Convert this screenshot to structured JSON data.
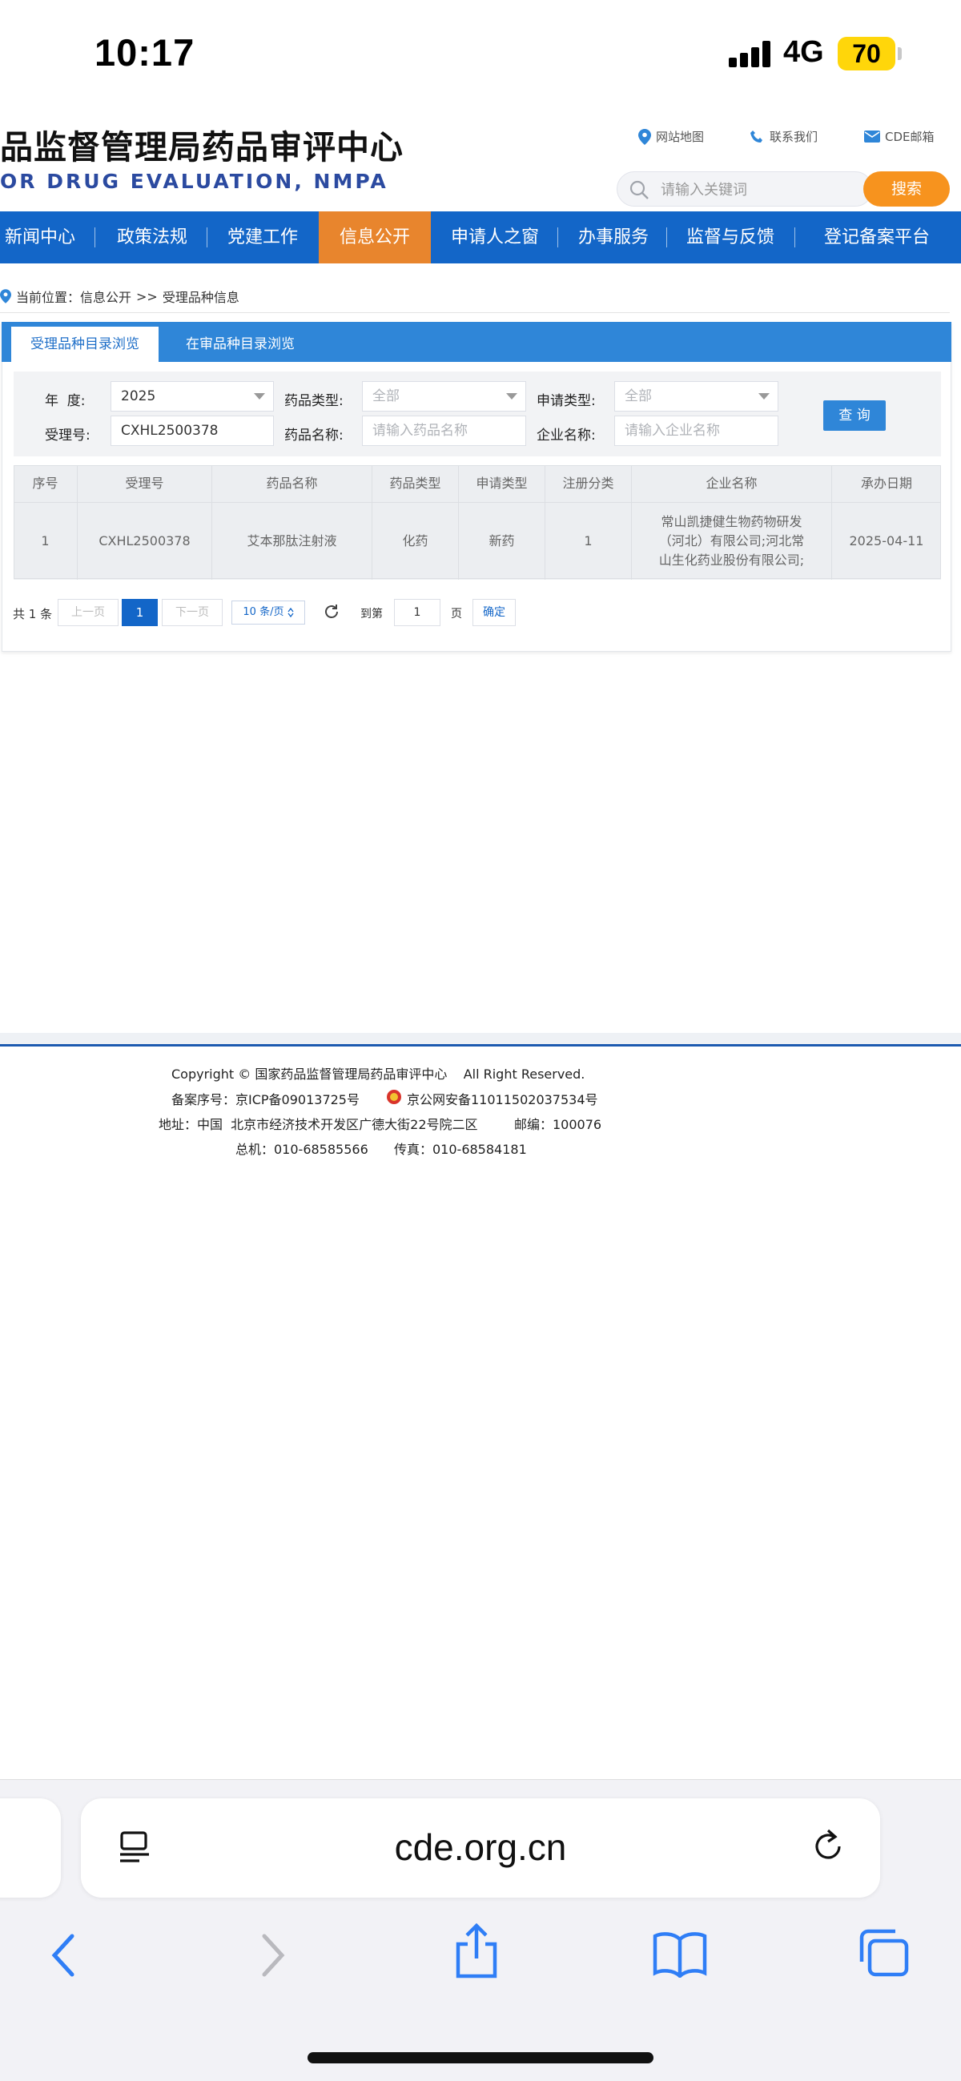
{
  "status_bar": {
    "time": "10:17",
    "network": "4G",
    "battery": "70"
  },
  "header": {
    "title": "品监督管理局药品审评中心",
    "subtitle": "OR DRUG EVALUATION, NMPA",
    "links": {
      "sitemap": "网站地图",
      "contact": "联系我们",
      "mail": "CDE邮箱"
    },
    "search_placeholder": "请输入关键词",
    "search_button": "搜索"
  },
  "nav": {
    "items": [
      "新闻中心",
      "政策法规",
      "党建工作",
      "信息公开",
      "申请人之窗",
      "办事服务",
      "监督与反馈",
      "登记备案平台"
    ],
    "active": "信息公开"
  },
  "breadcrumb": {
    "prefix": "当前位置：信息公开",
    "sep": ">>",
    "current": "受理品种信息"
  },
  "tabs": {
    "active": "受理品种目录浏览",
    "inactive": "在审品种目录浏览"
  },
  "filters": {
    "year_label": "年  度:",
    "year_value": "2025",
    "drug_type_label": "药品类型:",
    "drug_type_value": "全部",
    "apply_type_label": "申请类型:",
    "apply_type_value": "全部",
    "accept_no_label": "受理号:",
    "accept_no_value": "CXHL2500378",
    "drug_name_label": "药品名称:",
    "drug_name_placeholder": "请输入药品名称",
    "company_label": "企业名称:",
    "company_placeholder": "请输入企业名称",
    "query_button": "查 询"
  },
  "table": {
    "headers": [
      "序号",
      "受理号",
      "药品名称",
      "药品类型",
      "申请类型",
      "注册分类",
      "企业名称",
      "承办日期"
    ],
    "rows": [
      [
        "1",
        "CXHL2500378",
        "艾本那肽注射液",
        "化药",
        "新药",
        "1",
        "常山凯捷健生物药物研发（河北）有限公司;河北常山生化药业股份有限公司;",
        "2025-04-11"
      ]
    ]
  },
  "pagination": {
    "total": "共 1 条",
    "prev": "上一页",
    "current": "1",
    "next": "下一页",
    "page_size": "10 条/页",
    "goto_label": "到第",
    "goto_value": "1",
    "page_unit": "页",
    "confirm": "确定"
  },
  "footer": {
    "copyright": "Copyright © 国家药品监督管理局药品审评中心    All Right Reserved.",
    "icp": "备案序号：京ICP备09013725号",
    "police": "京公网安备11011502037534号",
    "address": "地址：中国  北京市经济技术开发区广德大街22号院二区",
    "postcode": "邮编：100076",
    "phone": "总机：010-68585566",
    "fax": "传真：010-68584181"
  },
  "browser": {
    "url": "cde.org.cn"
  },
  "colors": {
    "nav": "#1366c8",
    "nav_active": "#e8852d",
    "search_button": "#f7931e",
    "tab_bar": "#2f86d8"
  }
}
